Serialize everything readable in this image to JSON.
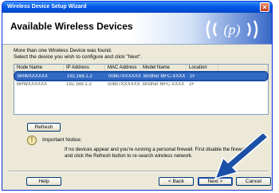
{
  "window": {
    "title": "Wireless Device Setup Wizard"
  },
  "header": {
    "title": "Available Wireless Devices"
  },
  "instructions": {
    "line1": "More than one Wireless Device was found.",
    "line2": "Select the device you wish to configure and click \"Next\"."
  },
  "list": {
    "columns": [
      "Node Name",
      "IP Address",
      "MAC Address",
      "Model Name",
      "Location"
    ],
    "rows": [
      {
        "node": "BRWXXXXXX",
        "ip": "192.168.1.2",
        "mac": "00807XXXXXX",
        "model": "Brother MFC-XXXX",
        "location": "1F",
        "selected": true
      },
      {
        "node": "BRWXXXXXX",
        "ip": "192.168.1.3",
        "mac": "00807XXXXXX",
        "model": "Brother MFC-XXXX",
        "location": "2F",
        "selected": false
      }
    ]
  },
  "buttons": {
    "refresh": "Refresh",
    "help": "Help",
    "back": "< Back",
    "next": "Next >",
    "cancel": "Cancel"
  },
  "notice": {
    "title": "Important Notice:",
    "body": "If no devices appear and you're running a personal firewall. First disable the firewall and click the Refresh button to re-search wireless network."
  },
  "colors": {
    "selection": "#316ac5",
    "pointer_arrow": "#1c4fa8"
  }
}
